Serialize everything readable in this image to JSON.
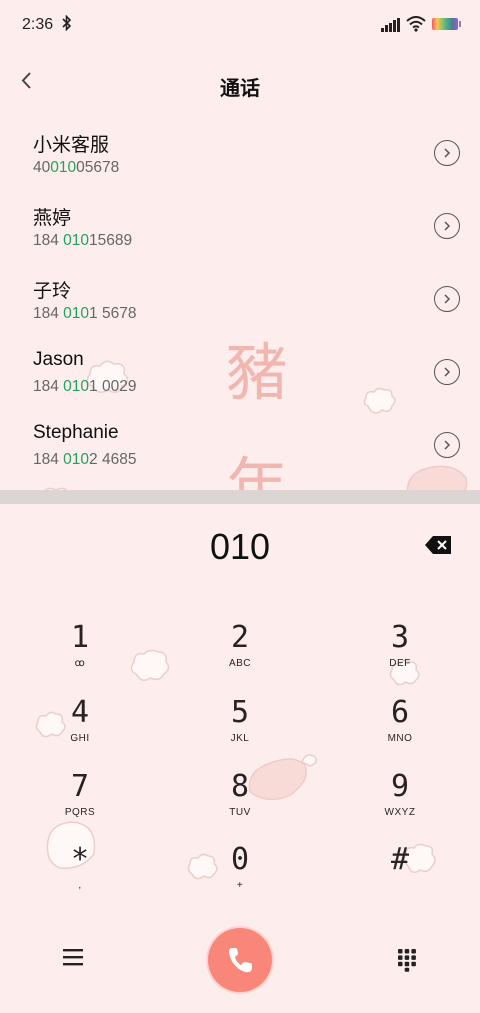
{
  "status_bar": {
    "time": "2:36"
  },
  "header": {
    "title": "通话"
  },
  "contacts": [
    {
      "name": "小米客服",
      "number_pre": "40",
      "number_hl": "010",
      "number_post": "05678"
    },
    {
      "name": "燕婷",
      "number_pre": "184 ",
      "number_hl": "010",
      "number_post": "15689"
    },
    {
      "name": "子玲",
      "number_pre": "184 ",
      "number_hl": "010",
      "number_post": "1 5678"
    },
    {
      "name": "Jason",
      "number_pre": "184 ",
      "number_hl": "010",
      "number_post": "1 0029"
    },
    {
      "name": "Stephanie",
      "number_pre": "184 ",
      "number_hl": "010",
      "number_post": "2 4685"
    }
  ],
  "watermark": {
    "char1": "豬",
    "char2": "年"
  },
  "dialer": {
    "entered": "010",
    "keys": [
      {
        "digit": "1",
        "letters": "ꝏ"
      },
      {
        "digit": "2",
        "letters": "ABC"
      },
      {
        "digit": "3",
        "letters": "DEF"
      },
      {
        "digit": "4",
        "letters": "GHI"
      },
      {
        "digit": "5",
        "letters": "JKL"
      },
      {
        "digit": "6",
        "letters": "MNO"
      },
      {
        "digit": "7",
        "letters": "PQRS"
      },
      {
        "digit": "8",
        "letters": "TUV"
      },
      {
        "digit": "9",
        "letters": "WXYZ"
      },
      {
        "digit": "*",
        "letters": ","
      },
      {
        "digit": "0",
        "letters": "+"
      },
      {
        "digit": "#",
        "letters": ""
      }
    ]
  },
  "colors": {
    "background": "#fdeeed",
    "highlight": "#21a35d",
    "call_button": "#f8877a"
  },
  "icons": [
    "back-icon",
    "bluetooth-icon",
    "signal-icon",
    "wifi-icon",
    "battery-icon",
    "chevron-right-icon",
    "backspace-icon",
    "menu-icon",
    "phone-icon",
    "keypad-icon"
  ]
}
